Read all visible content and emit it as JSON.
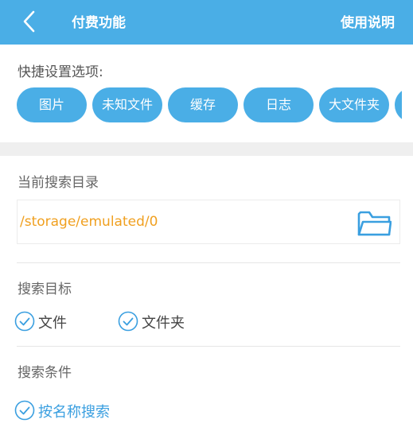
{
  "header": {
    "title": "付费功能",
    "help_label": "使用说明"
  },
  "quick_settings": {
    "label": "快捷设置选项:",
    "chips": [
      "图片",
      "未知文件",
      "缓存",
      "日志",
      "大文件夹"
    ]
  },
  "search_dir": {
    "label": "当前搜索目录",
    "path": "/storage/emulated/0"
  },
  "search_target": {
    "label": "搜索目标",
    "options": [
      {
        "label": "文件",
        "checked": true
      },
      {
        "label": "文件夹",
        "checked": true
      }
    ]
  },
  "search_condition": {
    "label": "搜索条件",
    "options": [
      {
        "label": "按名称搜索",
        "checked": true
      }
    ]
  },
  "colors": {
    "accent": "#4aaee6",
    "path_text": "#f0a020",
    "checked_text": "#3a9fe0"
  }
}
